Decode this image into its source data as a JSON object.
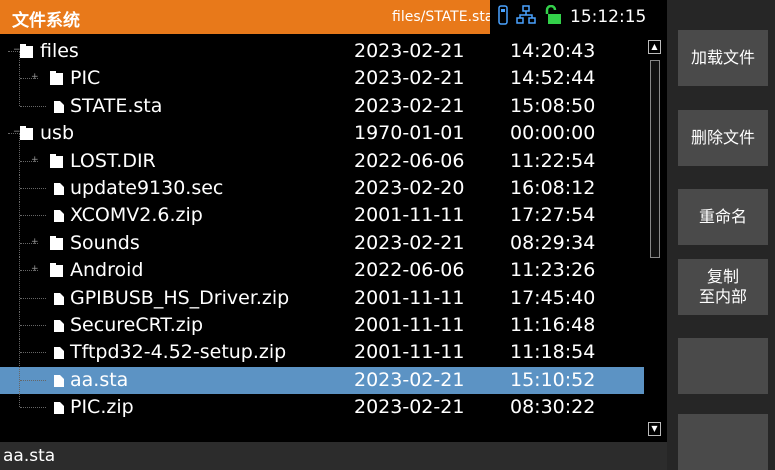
{
  "header": {
    "title": "文件系统",
    "path": "files/STATE.sta",
    "time": "15:12:15",
    "icons": [
      "usb-drive-icon",
      "network-icon",
      "unlock-icon"
    ]
  },
  "files": [
    {
      "name": "files",
      "type": "folder",
      "date": "2023-02-21",
      "time": "14:20:43"
    },
    {
      "name": "PIC",
      "type": "folder",
      "date": "2023-02-21",
      "time": "14:52:44"
    },
    {
      "name": "STATE.sta",
      "type": "file",
      "date": "2023-02-21",
      "time": "15:08:50"
    },
    {
      "name": "usb",
      "type": "folder",
      "date": "1970-01-01",
      "time": "00:00:00"
    },
    {
      "name": "LOST.DIR",
      "type": "folder",
      "date": "2022-06-06",
      "time": "11:22:54"
    },
    {
      "name": "update9130.sec",
      "type": "file",
      "date": "2023-02-20",
      "time": "16:08:12"
    },
    {
      "name": "XCOMV2.6.zip",
      "type": "file",
      "date": "2001-11-11",
      "time": "17:27:54"
    },
    {
      "name": "Sounds",
      "type": "folder",
      "date": "2023-02-21",
      "time": "08:29:34"
    },
    {
      "name": "Android",
      "type": "folder",
      "date": "2022-06-06",
      "time": "11:23:26"
    },
    {
      "name": "GPIBUSB_HS_Driver.zip",
      "type": "file",
      "date": "2001-11-11",
      "time": "17:45:40"
    },
    {
      "name": "SecureCRT.zip",
      "type": "file",
      "date": "2001-11-11",
      "time": "11:16:48"
    },
    {
      "name": "Tftpd32-4.52-setup.zip",
      "type": "file",
      "date": "2001-11-11",
      "time": "11:18:54"
    },
    {
      "name": "aa.sta",
      "type": "file",
      "date": "2023-02-21",
      "time": "15:10:52",
      "selected": true
    },
    {
      "name": "PIC.zip",
      "type": "file",
      "date": "2023-02-21",
      "time": "08:30:22"
    }
  ],
  "status": {
    "text": "aa.sta"
  },
  "side_buttons": [
    {
      "label": "加载文件"
    },
    {
      "label": "删除文件"
    },
    {
      "label": "重命名"
    },
    {
      "label": "复制\n至内部"
    },
    {
      "label": ""
    },
    {
      "label": ""
    }
  ],
  "colors": {
    "header": "#e8791a",
    "selection": "#5c93c4",
    "background": "#000000"
  }
}
